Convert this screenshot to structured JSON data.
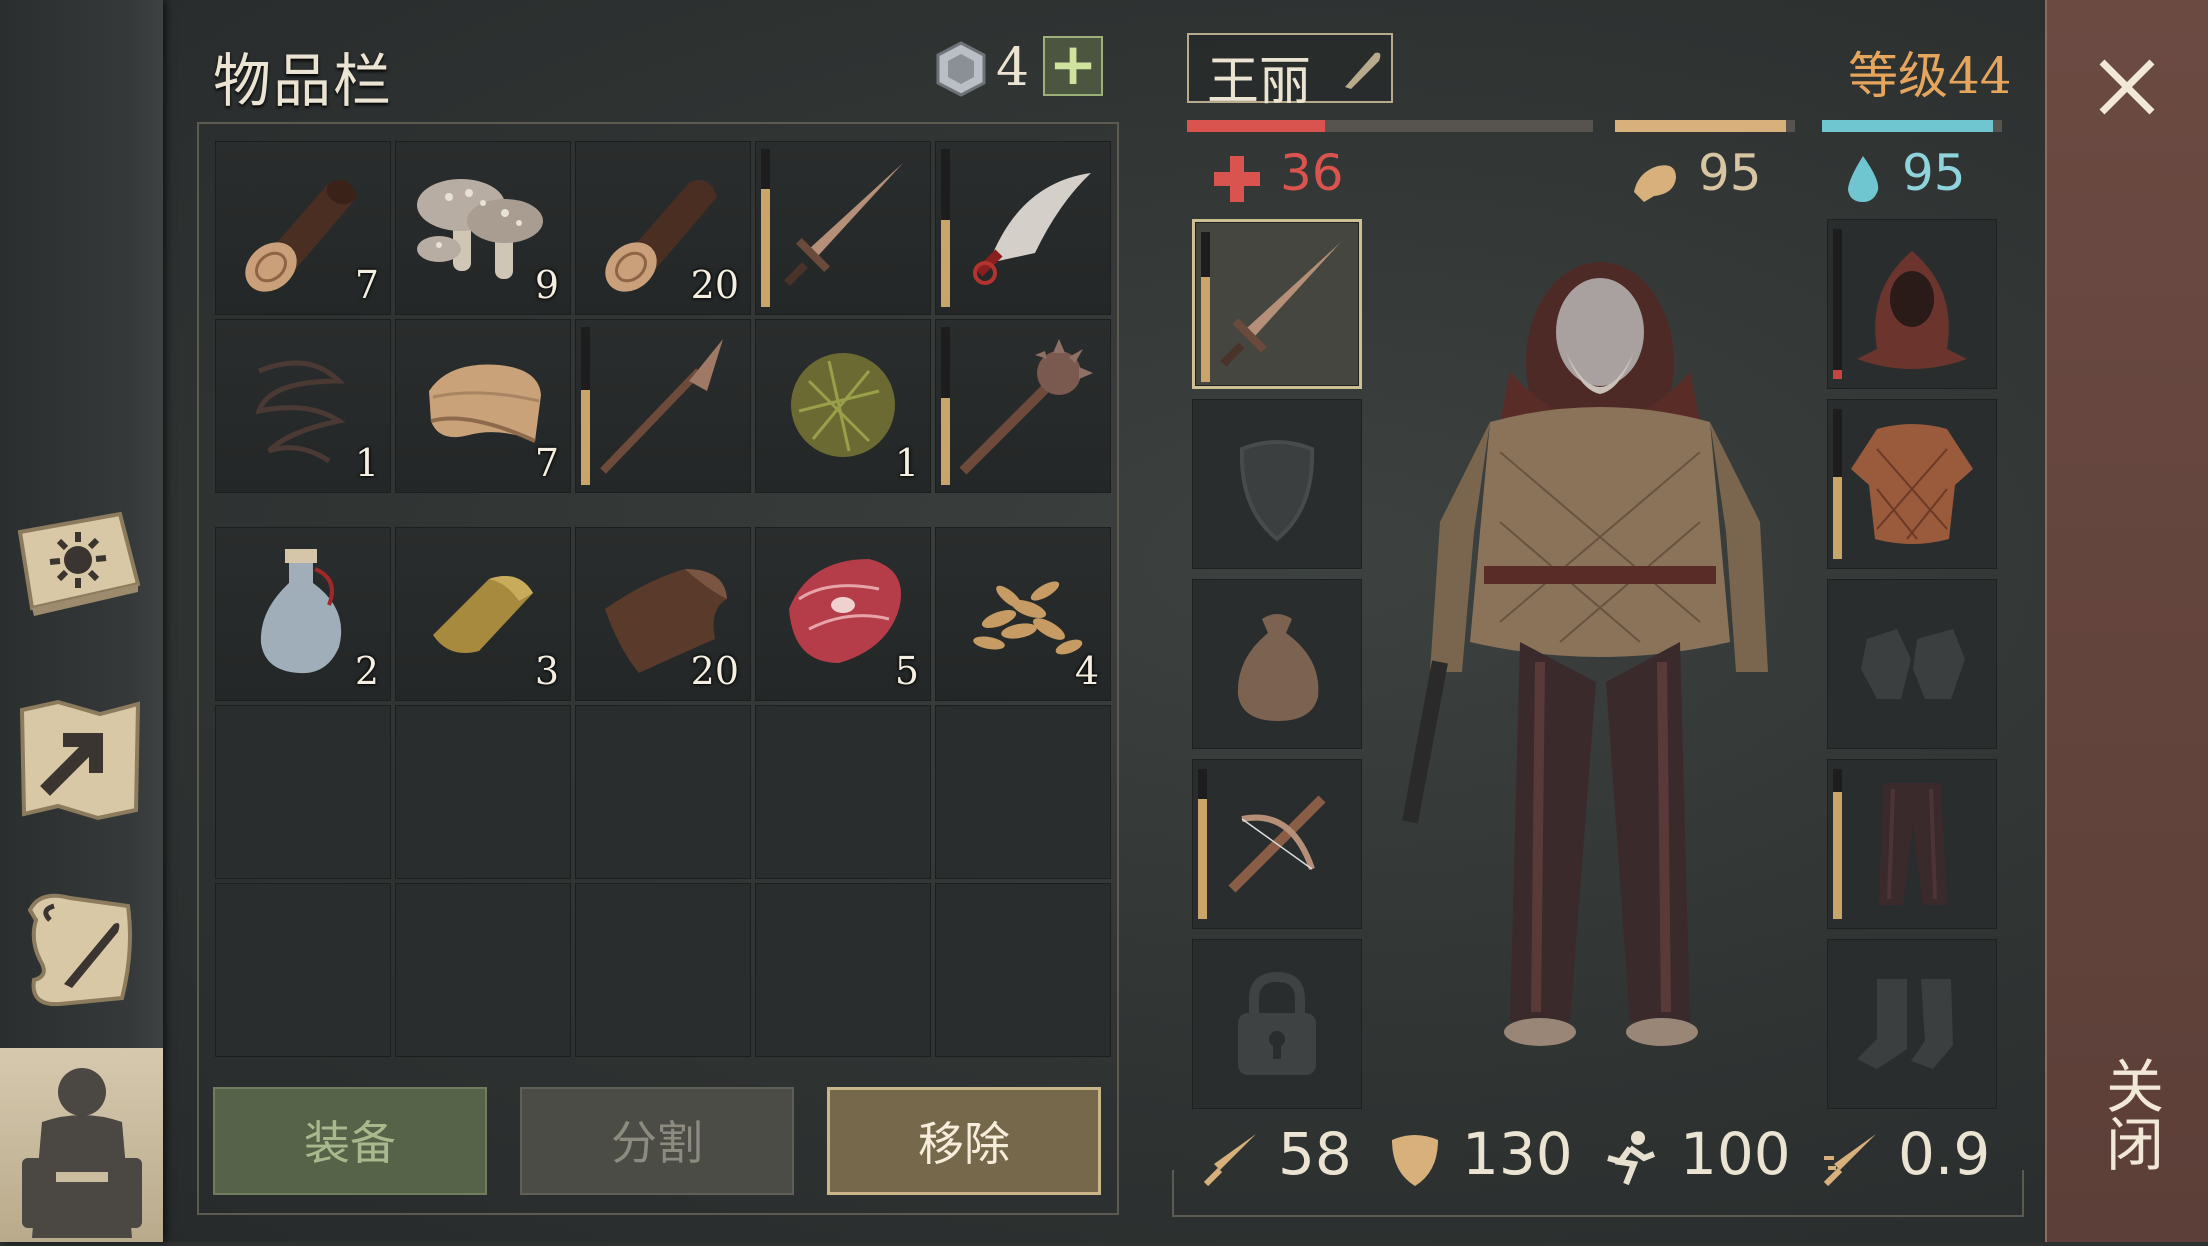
{
  "inventory": {
    "title": "物品栏",
    "coins": "4",
    "add_label": "+",
    "items": [
      {
        "icon": "log-icon",
        "qty": "7"
      },
      {
        "icon": "mushroom-icon",
        "qty": "9"
      },
      {
        "icon": "log-icon",
        "qty": "20"
      },
      {
        "icon": "sword-icon",
        "qty": "",
        "durability": 0.75
      },
      {
        "icon": "scimitar-icon",
        "qty": "",
        "durability": 0.55
      },
      {
        "icon": "rope-icon",
        "qty": "1"
      },
      {
        "icon": "cloth-icon",
        "qty": "7"
      },
      {
        "icon": "spear-icon",
        "qty": "",
        "durability": 0.6
      },
      {
        "icon": "fiber-ball-icon",
        "qty": "1"
      },
      {
        "icon": "mace-icon",
        "qty": "",
        "durability": 0.55
      },
      {
        "icon": "potion-icon",
        "qty": "2"
      },
      {
        "icon": "gold-ingot-icon",
        "qty": "3"
      },
      {
        "icon": "leather-icon",
        "qty": "20"
      },
      {
        "icon": "raw-meat-icon",
        "qty": "5"
      },
      {
        "icon": "seeds-icon",
        "qty": "4"
      }
    ],
    "buttons": {
      "equip": "装备",
      "split": "分割",
      "remove": "移除"
    }
  },
  "character": {
    "name": "王丽",
    "level": "等级44",
    "health": "36",
    "food": "95",
    "water": "95",
    "health_fill": 0.34,
    "food_fill": 0.95,
    "water_fill": 0.95,
    "attack": "58",
    "defense": "130",
    "speed": "100",
    "attack_speed": "0.9"
  },
  "colors": {
    "health": "#d9534f",
    "food": "#d8b07c",
    "water": "#6fc6d0",
    "level": "#e6a55c"
  },
  "close_label": "关闭"
}
